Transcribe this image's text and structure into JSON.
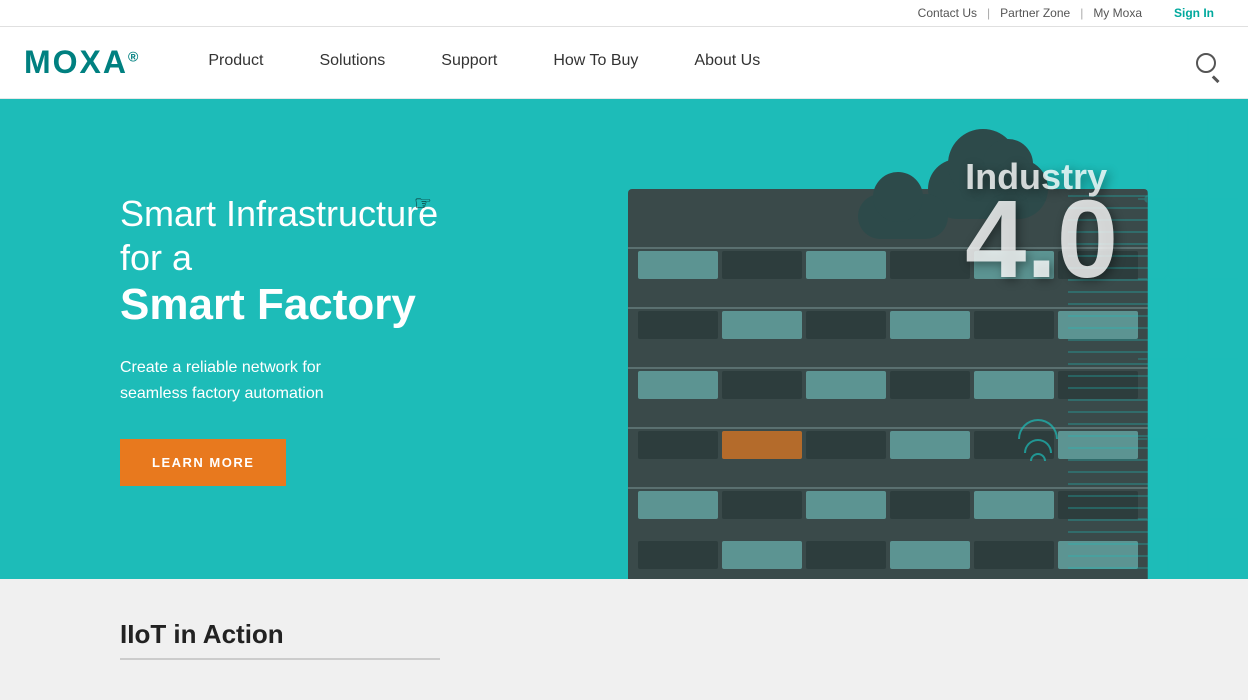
{
  "topbar": {
    "contact_us": "Contact Us",
    "partner_zone": "Partner Zone",
    "my_moxa": "My Moxa",
    "sign_in": "Sign In",
    "separator": "|"
  },
  "header": {
    "logo_text": "MOXA",
    "logo_reg": "®",
    "nav": [
      {
        "label": "Product",
        "id": "nav-product"
      },
      {
        "label": "Solutions",
        "id": "nav-solutions"
      },
      {
        "label": "Support",
        "id": "nav-support"
      },
      {
        "label": "How To Buy",
        "id": "nav-how-to-buy"
      },
      {
        "label": "About Us",
        "id": "nav-about-us"
      }
    ],
    "search_aria": "Search"
  },
  "hero": {
    "title_line1": "Smart Infrastructure for a",
    "title_line2": "Smart Factory",
    "subtitle_line1": "Create a reliable network for",
    "subtitle_line2": "seamless factory automation",
    "cta_label": "LEARN MORE",
    "industry_label": "Industry",
    "industry_number": "4.0"
  },
  "bottom": {
    "section_title": "IIoT in Action"
  }
}
